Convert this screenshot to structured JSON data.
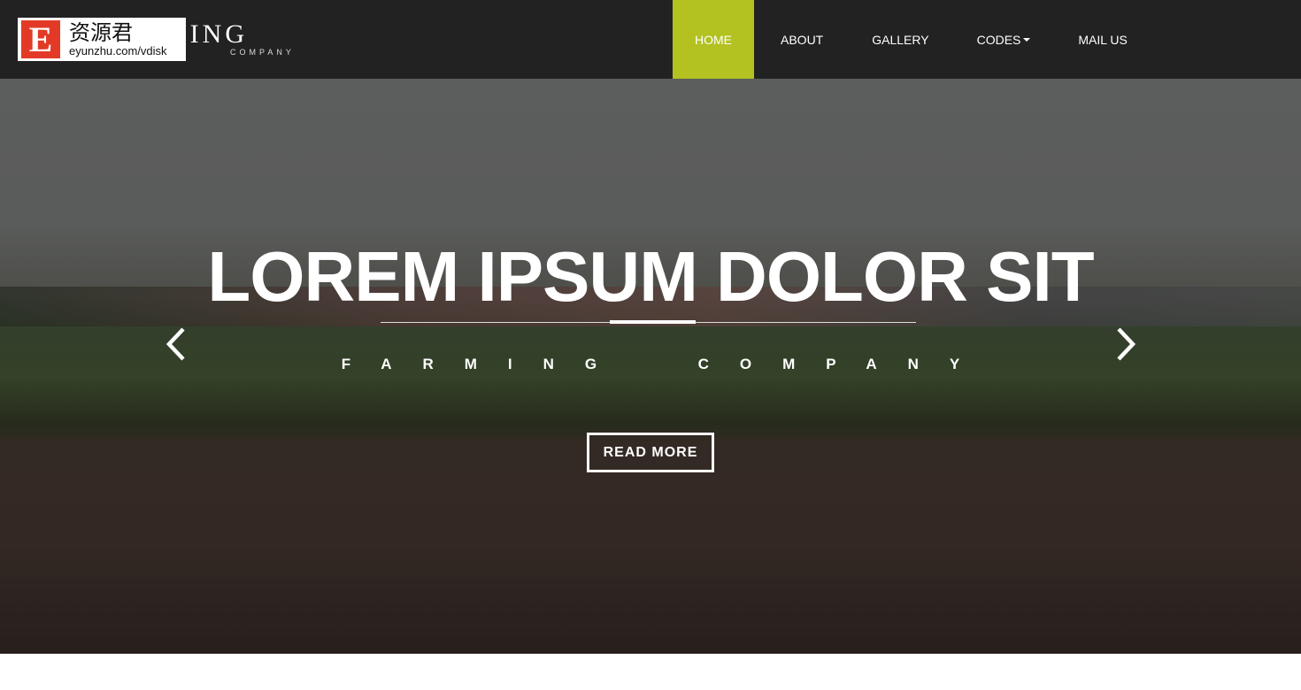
{
  "brand": {
    "name": "FARMING",
    "visible_name": "RMING",
    "subtitle": "COMPANY"
  },
  "watermark": {
    "letter": "E",
    "text_cn": "资源君",
    "url": "eyunzhu.com/vdisk"
  },
  "nav": {
    "items": [
      {
        "label": "HOME",
        "active": true
      },
      {
        "label": "ABOUT"
      },
      {
        "label": "GALLERY"
      },
      {
        "label": "CODES",
        "dropdown": true
      },
      {
        "label": "MAIL US"
      }
    ]
  },
  "colors": {
    "accent": "#b3c121",
    "header_bg": "#222222"
  },
  "hero": {
    "title": "LOREM IPSUM DOLOR SIT",
    "subtitle": "FARMING  COMPANY",
    "button": "READ MORE",
    "prev_icon": "chevron-left-icon",
    "next_icon": "chevron-right-icon"
  }
}
